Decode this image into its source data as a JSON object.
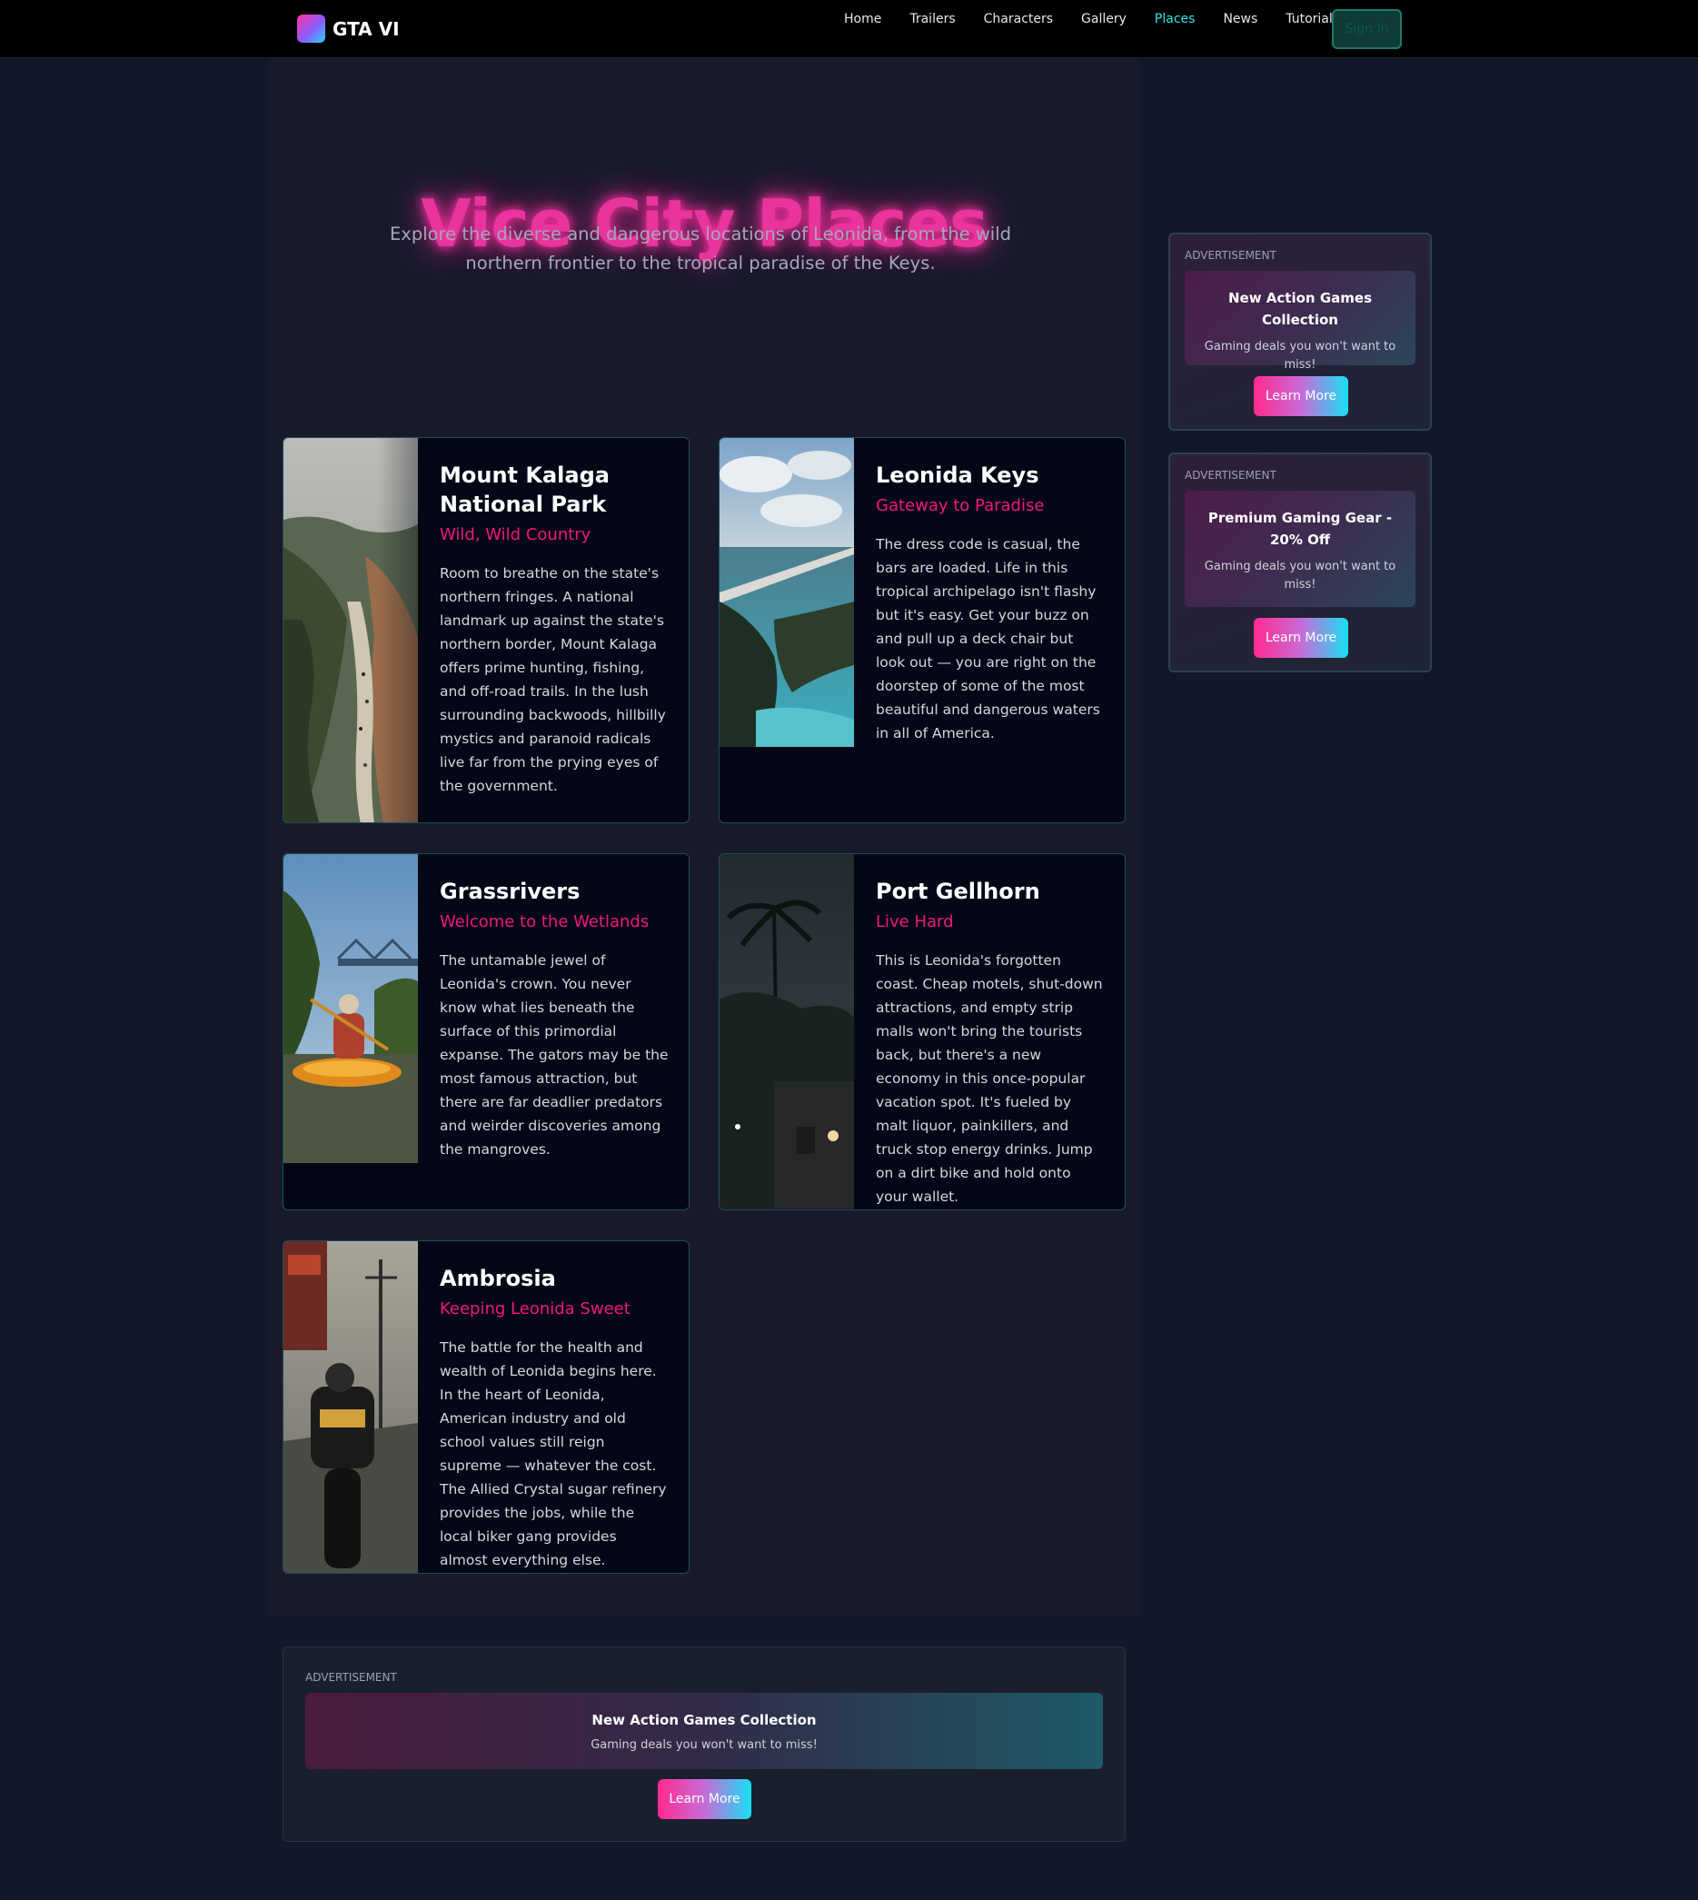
{
  "nav": {
    "logo_text": "GTA VI",
    "links": [
      "Home",
      "Trailers",
      "Characters",
      "Gallery",
      "Places",
      "News",
      "Tutorials"
    ],
    "active": "Places",
    "signin_label": "Sign In"
  },
  "hero": {
    "title": "Vice City Places",
    "subtitle": "Explore the diverse and dangerous locations of Leonida, from the wild northern frontier to the tropical paradise of the Keys."
  },
  "places": [
    {
      "title": "Mount Kalaga National Park",
      "tagline": "Wild, Wild Country",
      "description": "Room to breathe on the state's northern fringes. A national landmark up against the state's northern border, Mount Kalaga offers prime hunting, fishing, and off-road trails. In the lush surrounding backwoods, hillbilly mystics and paranoid radicals live far from the prying eyes of the government."
    },
    {
      "title": "Leonida Keys",
      "tagline": "Gateway to Paradise",
      "description": "The dress code is casual, the bars are loaded. Life in this tropical archipelago isn't flashy but it's easy. Get your buzz on and pull up a deck chair but look out — you are right on the doorstep of some of the most beautiful and dangerous waters in all of America."
    },
    {
      "title": "Grassrivers",
      "tagline": "Welcome to the Wetlands",
      "description": "The untamable jewel of Leonida's crown. You never know what lies beneath the surface of this primordial expanse. The gators may be the most famous attraction, but there are far deadlier predators and weirder discoveries among the mangroves."
    },
    {
      "title": "Port Gellhorn",
      "tagline": "Live Hard",
      "description": "This is Leonida's forgotten coast. Cheap motels, shut-down attractions, and empty strip malls won't bring the tourists back, but there's a new economy in this once-popular vacation spot. It's fueled by malt liquor, painkillers, and truck stop energy drinks. Jump on a dirt bike and hold onto your wallet."
    },
    {
      "title": "Ambrosia",
      "tagline": "Keeping Leonida Sweet",
      "description": "The battle for the health and wealth of Leonida begins here. In the heart of Leonida, American industry and old school values still reign supreme — whatever the cost. The Allied Crystal sugar refinery provides the jobs, while the local biker gang provides almost everything else."
    }
  ],
  "ads": {
    "label": "Advertisement",
    "side": [
      {
        "title": "New Action Games Collection",
        "text": "Gaming deals you won't want to miss!",
        "button": "Learn More"
      },
      {
        "title": "Premium Gaming Gear - 20% Off",
        "text": "Gaming deals you won't want to miss!",
        "button": "Learn More"
      }
    ],
    "bottom": {
      "title": "New Action Games Collection",
      "text": "Gaming deals you won't want to miss!",
      "button": "Learn More"
    }
  },
  "colors": {
    "accent_pink": "#f0177f",
    "accent_cyan": "#2ee6e6",
    "background": "#121829"
  }
}
